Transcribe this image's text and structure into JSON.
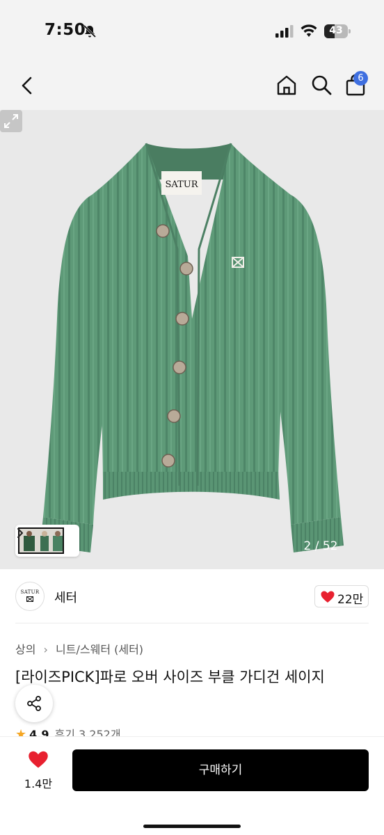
{
  "status_bar": {
    "time": "7:50",
    "battery": "43",
    "battery_level": 0.43
  },
  "nav": {
    "cart_count": "6"
  },
  "gallery": {
    "counter": "2 / 52",
    "label_text": "SATUR"
  },
  "brand": {
    "name": "세터",
    "logo_text": "SATUR",
    "likes": "22만"
  },
  "product": {
    "breadcrumb": [
      "상의",
      "니트/스웨터 (세터)"
    ],
    "title": "[라이즈PICK]파로 오버 사이즈 부클 가디건 세이지",
    "rating": "4.9",
    "reviews": "후기 3,252개"
  },
  "bottom": {
    "wish_count": "1.4만",
    "buy_label": "구매하기"
  },
  "colors": {
    "accent": "#3f6fe0",
    "heart": "#e8202f",
    "product_green": "#5e9a78"
  }
}
